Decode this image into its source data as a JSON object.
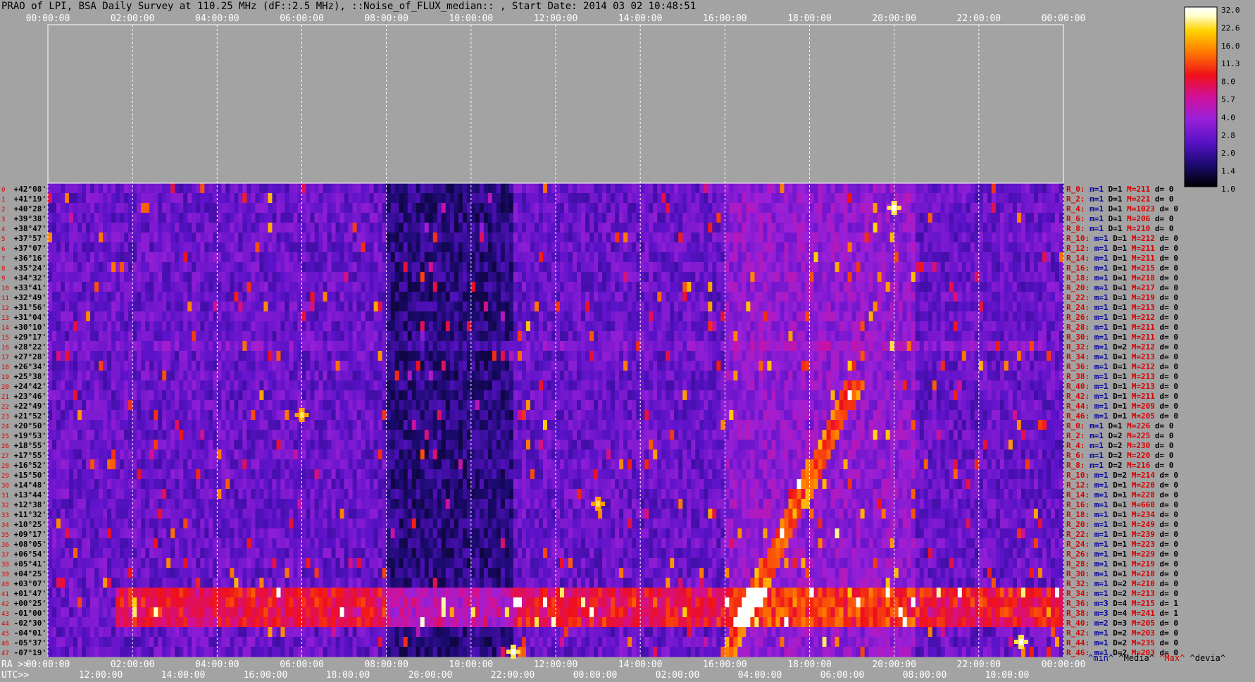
{
  "title": "PRAO of LPI, BSA Daily Survey at 110.25 MHz (dF::2.5 MHz), ::Noise_of_FLUX_median:: , Start Date: 2014 03 02 10:48:51",
  "axis_labels": {
    "ra": "RA >>",
    "utc": "UTC>>"
  },
  "colors": {
    "background": "#a3a3a3",
    "row_label": "#d60000",
    "dec_label": "#000000",
    "ticks": "#ffffff"
  },
  "chart_data": {
    "type": "heatmap",
    "title": "PRAO of LPI, BSA Daily Survey at 110.25 MHz (dF::2.5 MHz), ::Noise_of_FLUX_median:: , Start Date: 2014 03 02 10:48:51",
    "x_top_ticks": [
      "00:00:00",
      "02:00:00",
      "04:00:00",
      "06:00:00",
      "08:00:00",
      "10:00:00",
      "12:00:00",
      "14:00:00",
      "16:00:00",
      "18:00:00",
      "20:00:00",
      "22:00:00",
      "00:00:00"
    ],
    "x_ra_ticks": [
      "00:00:00",
      "02:00:00",
      "04:00:00",
      "06:00:00",
      "08:00:00",
      "10:00:00",
      "12:00:00",
      "14:00:00",
      "16:00:00",
      "18:00:00",
      "20:00:00",
      "22:00:00",
      "00:00:00"
    ],
    "x_utc_ticks": [
      "12:00:00",
      "14:00:00",
      "16:00:00",
      "18:00:00",
      "20:00:00",
      "22:00:00",
      "00:00:00",
      "02:00:00",
      "04:00:00",
      "06:00:00",
      "08:00:00",
      "10:00:00"
    ],
    "colorbar": {
      "ticks": [
        "32.0",
        "22.6",
        "16.0",
        "11.3",
        "8.0",
        "5.7",
        "4.0",
        "2.8",
        "2.0",
        "1.4",
        "1.0"
      ],
      "range": [
        1.0,
        32.0
      ],
      "scale": "log2",
      "colors": [
        "#000000",
        "#1a0a6e",
        "#5a12c8",
        "#9a20d8",
        "#d0109a",
        "#f0101a",
        "#ff7a00",
        "#ffd400",
        "#ffffc8",
        "#ffffff"
      ]
    },
    "declinations": [
      "+42°08'",
      "+41°19'",
      "+40°28'",
      "+39°38'",
      "+38°47'",
      "+37°57'",
      "+37°07'",
      "+36°16'",
      "+35°24'",
      "+34°32'",
      "+33°41'",
      "+32°49'",
      "+31°56'",
      "+31°04'",
      "+30°10'",
      "+29°17'",
      "+28°22'",
      "+27°28'",
      "+26°34'",
      "+25°38'",
      "+24°42'",
      "+23°46'",
      "+22°49'",
      "+21°52'",
      "+20°50'",
      "+19°53'",
      "+18°55'",
      "+17°55'",
      "+16°52'",
      "+15°50'",
      "+14°48'",
      "+13°44'",
      "+12°38'",
      "+11°32'",
      "+10°25'",
      "+09°17'",
      "+08°05'",
      "+06°54'",
      "+05°41'",
      "+04°25'",
      "+03°07'",
      "+01°47'",
      "+00°25'",
      "-01°00'",
      "-02°30'",
      "-04°01'",
      "-05°37'",
      "-07°19'"
    ],
    "row_numbers": [
      "0",
      "1",
      "2",
      "3",
      "4",
      "5",
      "6",
      "7",
      "8",
      "9",
      "10",
      "11",
      "12",
      "13",
      "14",
      "15",
      "16",
      "17",
      "18",
      "19",
      "20",
      "21",
      "22",
      "23",
      "24",
      "25",
      "26",
      "27",
      "28",
      "29",
      "30",
      "31",
      "32",
      "33",
      "34",
      "35",
      "36",
      "37",
      "38",
      "39",
      "40",
      "41",
      "42",
      "43",
      "44",
      "45",
      "46",
      "47"
    ],
    "receivers": [
      {
        "r": "R_0:",
        "m": "1",
        "D": "1",
        "M": "211",
        "d": "0"
      },
      {
        "r": "R_2:",
        "m": "1",
        "D": "1",
        "M": "221",
        "d": "0"
      },
      {
        "r": "R_4:",
        "m": "1",
        "D": "1",
        "M": "1023",
        "d": "0"
      },
      {
        "r": "R_6:",
        "m": "1",
        "D": "1",
        "M": "206",
        "d": "0"
      },
      {
        "r": "R_8:",
        "m": "1",
        "D": "1",
        "M": "210",
        "d": "0"
      },
      {
        "r": "R_10:",
        "m": "1",
        "D": "1",
        "M": "212",
        "d": "0"
      },
      {
        "r": "R_12:",
        "m": "1",
        "D": "1",
        "M": "211",
        "d": "0"
      },
      {
        "r": "R_14:",
        "m": "1",
        "D": "1",
        "M": "211",
        "d": "0"
      },
      {
        "r": "R_16:",
        "m": "1",
        "D": "1",
        "M": "215",
        "d": "0"
      },
      {
        "r": "R_18:",
        "m": "1",
        "D": "1",
        "M": "218",
        "d": "0"
      },
      {
        "r": "R_20:",
        "m": "1",
        "D": "1",
        "M": "217",
        "d": "0"
      },
      {
        "r": "R_22:",
        "m": "1",
        "D": "1",
        "M": "219",
        "d": "0"
      },
      {
        "r": "R_24:",
        "m": "1",
        "D": "1",
        "M": "213",
        "d": "0"
      },
      {
        "r": "R_26:",
        "m": "1",
        "D": "1",
        "M": "212",
        "d": "0"
      },
      {
        "r": "R_28:",
        "m": "1",
        "D": "1",
        "M": "211",
        "d": "0"
      },
      {
        "r": "R_30:",
        "m": "1",
        "D": "1",
        "M": "211",
        "d": "0"
      },
      {
        "r": "R_32:",
        "m": "1",
        "D": "2",
        "M": "212",
        "d": "0"
      },
      {
        "r": "R_34:",
        "m": "1",
        "D": "1",
        "M": "213",
        "d": "0"
      },
      {
        "r": "R_36:",
        "m": "1",
        "D": "1",
        "M": "212",
        "d": "0"
      },
      {
        "r": "R_38:",
        "m": "1",
        "D": "1",
        "M": "213",
        "d": "0"
      },
      {
        "r": "R_40:",
        "m": "1",
        "D": "1",
        "M": "213",
        "d": "0"
      },
      {
        "r": "R_42:",
        "m": "1",
        "D": "1",
        "M": "211",
        "d": "0"
      },
      {
        "r": "R_44:",
        "m": "1",
        "D": "1",
        "M": "209",
        "d": "0"
      },
      {
        "r": "R_46:",
        "m": "1",
        "D": "1",
        "M": "205",
        "d": "0"
      },
      {
        "r": "R_0:",
        "m": "1",
        "D": "1",
        "M": "226",
        "d": "0"
      },
      {
        "r": "R_2:",
        "m": "1",
        "D": "2",
        "M": "225",
        "d": "0"
      },
      {
        "r": "R_4:",
        "m": "1",
        "D": "2",
        "M": "230",
        "d": "0"
      },
      {
        "r": "R_6:",
        "m": "1",
        "D": "2",
        "M": "220",
        "d": "0"
      },
      {
        "r": "R_8:",
        "m": "1",
        "D": "2",
        "M": "216",
        "d": "0"
      },
      {
        "r": "R_10:",
        "m": "1",
        "D": "2",
        "M": "214",
        "d": "0"
      },
      {
        "r": "R_12:",
        "m": "1",
        "D": "1",
        "M": "220",
        "d": "0"
      },
      {
        "r": "R_14:",
        "m": "1",
        "D": "1",
        "M": "228",
        "d": "0"
      },
      {
        "r": "R_16:",
        "m": "1",
        "D": "1",
        "M": "660",
        "d": "0"
      },
      {
        "r": "R_18:",
        "m": "1",
        "D": "1",
        "M": "234",
        "d": "0"
      },
      {
        "r": "R_20:",
        "m": "1",
        "D": "1",
        "M": "249",
        "d": "0"
      },
      {
        "r": "R_22:",
        "m": "1",
        "D": "1",
        "M": "239",
        "d": "0"
      },
      {
        "r": "R_24:",
        "m": "1",
        "D": "1",
        "M": "223",
        "d": "0"
      },
      {
        "r": "R_26:",
        "m": "1",
        "D": "1",
        "M": "229",
        "d": "0"
      },
      {
        "r": "R_28:",
        "m": "1",
        "D": "1",
        "M": "219",
        "d": "0"
      },
      {
        "r": "R_30:",
        "m": "1",
        "D": "1",
        "M": "218",
        "d": "0"
      },
      {
        "r": "R_32:",
        "m": "1",
        "D": "2",
        "M": "210",
        "d": "0"
      },
      {
        "r": "R_34:",
        "m": "1",
        "D": "2",
        "M": "213",
        "d": "0"
      },
      {
        "r": "R_36:",
        "m": "3",
        "D": "4",
        "M": "215",
        "d": "1"
      },
      {
        "r": "R_38:",
        "m": "3",
        "D": "4",
        "M": "241",
        "d": "1"
      },
      {
        "r": "R_40:",
        "m": "2",
        "D": "3",
        "M": "205",
        "d": "0"
      },
      {
        "r": "R_42:",
        "m": "1",
        "D": "2",
        "M": "203",
        "d": "0"
      },
      {
        "r": "R_44:",
        "m": "1",
        "D": "2",
        "M": "235",
        "d": "0"
      },
      {
        "r": "R_46:",
        "m": "1",
        "D": "2",
        "M": "203",
        "d": "0"
      }
    ],
    "legend": {
      "min": "^min^",
      "media": "^Media^",
      "max": "^Max^",
      "devia": "^devia^"
    },
    "features": [
      {
        "label": "bright source",
        "ra": "20:00:00",
        "dec": "+40°28'",
        "level": 32.0
      },
      {
        "label": "bright source",
        "ra": "06:00:00",
        "dec": "+21°52'",
        "level": 22.6
      },
      {
        "label": "bright source",
        "ra": "13:00:00",
        "dec": "+12°38'",
        "level": 22.6
      },
      {
        "label": "bright source",
        "ra": "23:00:00",
        "dec": "-05°37'",
        "level": 32.0
      },
      {
        "label": "bright source",
        "ra": "11:00:00",
        "dec": "-07°19'",
        "level": 32.0
      }
    ]
  }
}
